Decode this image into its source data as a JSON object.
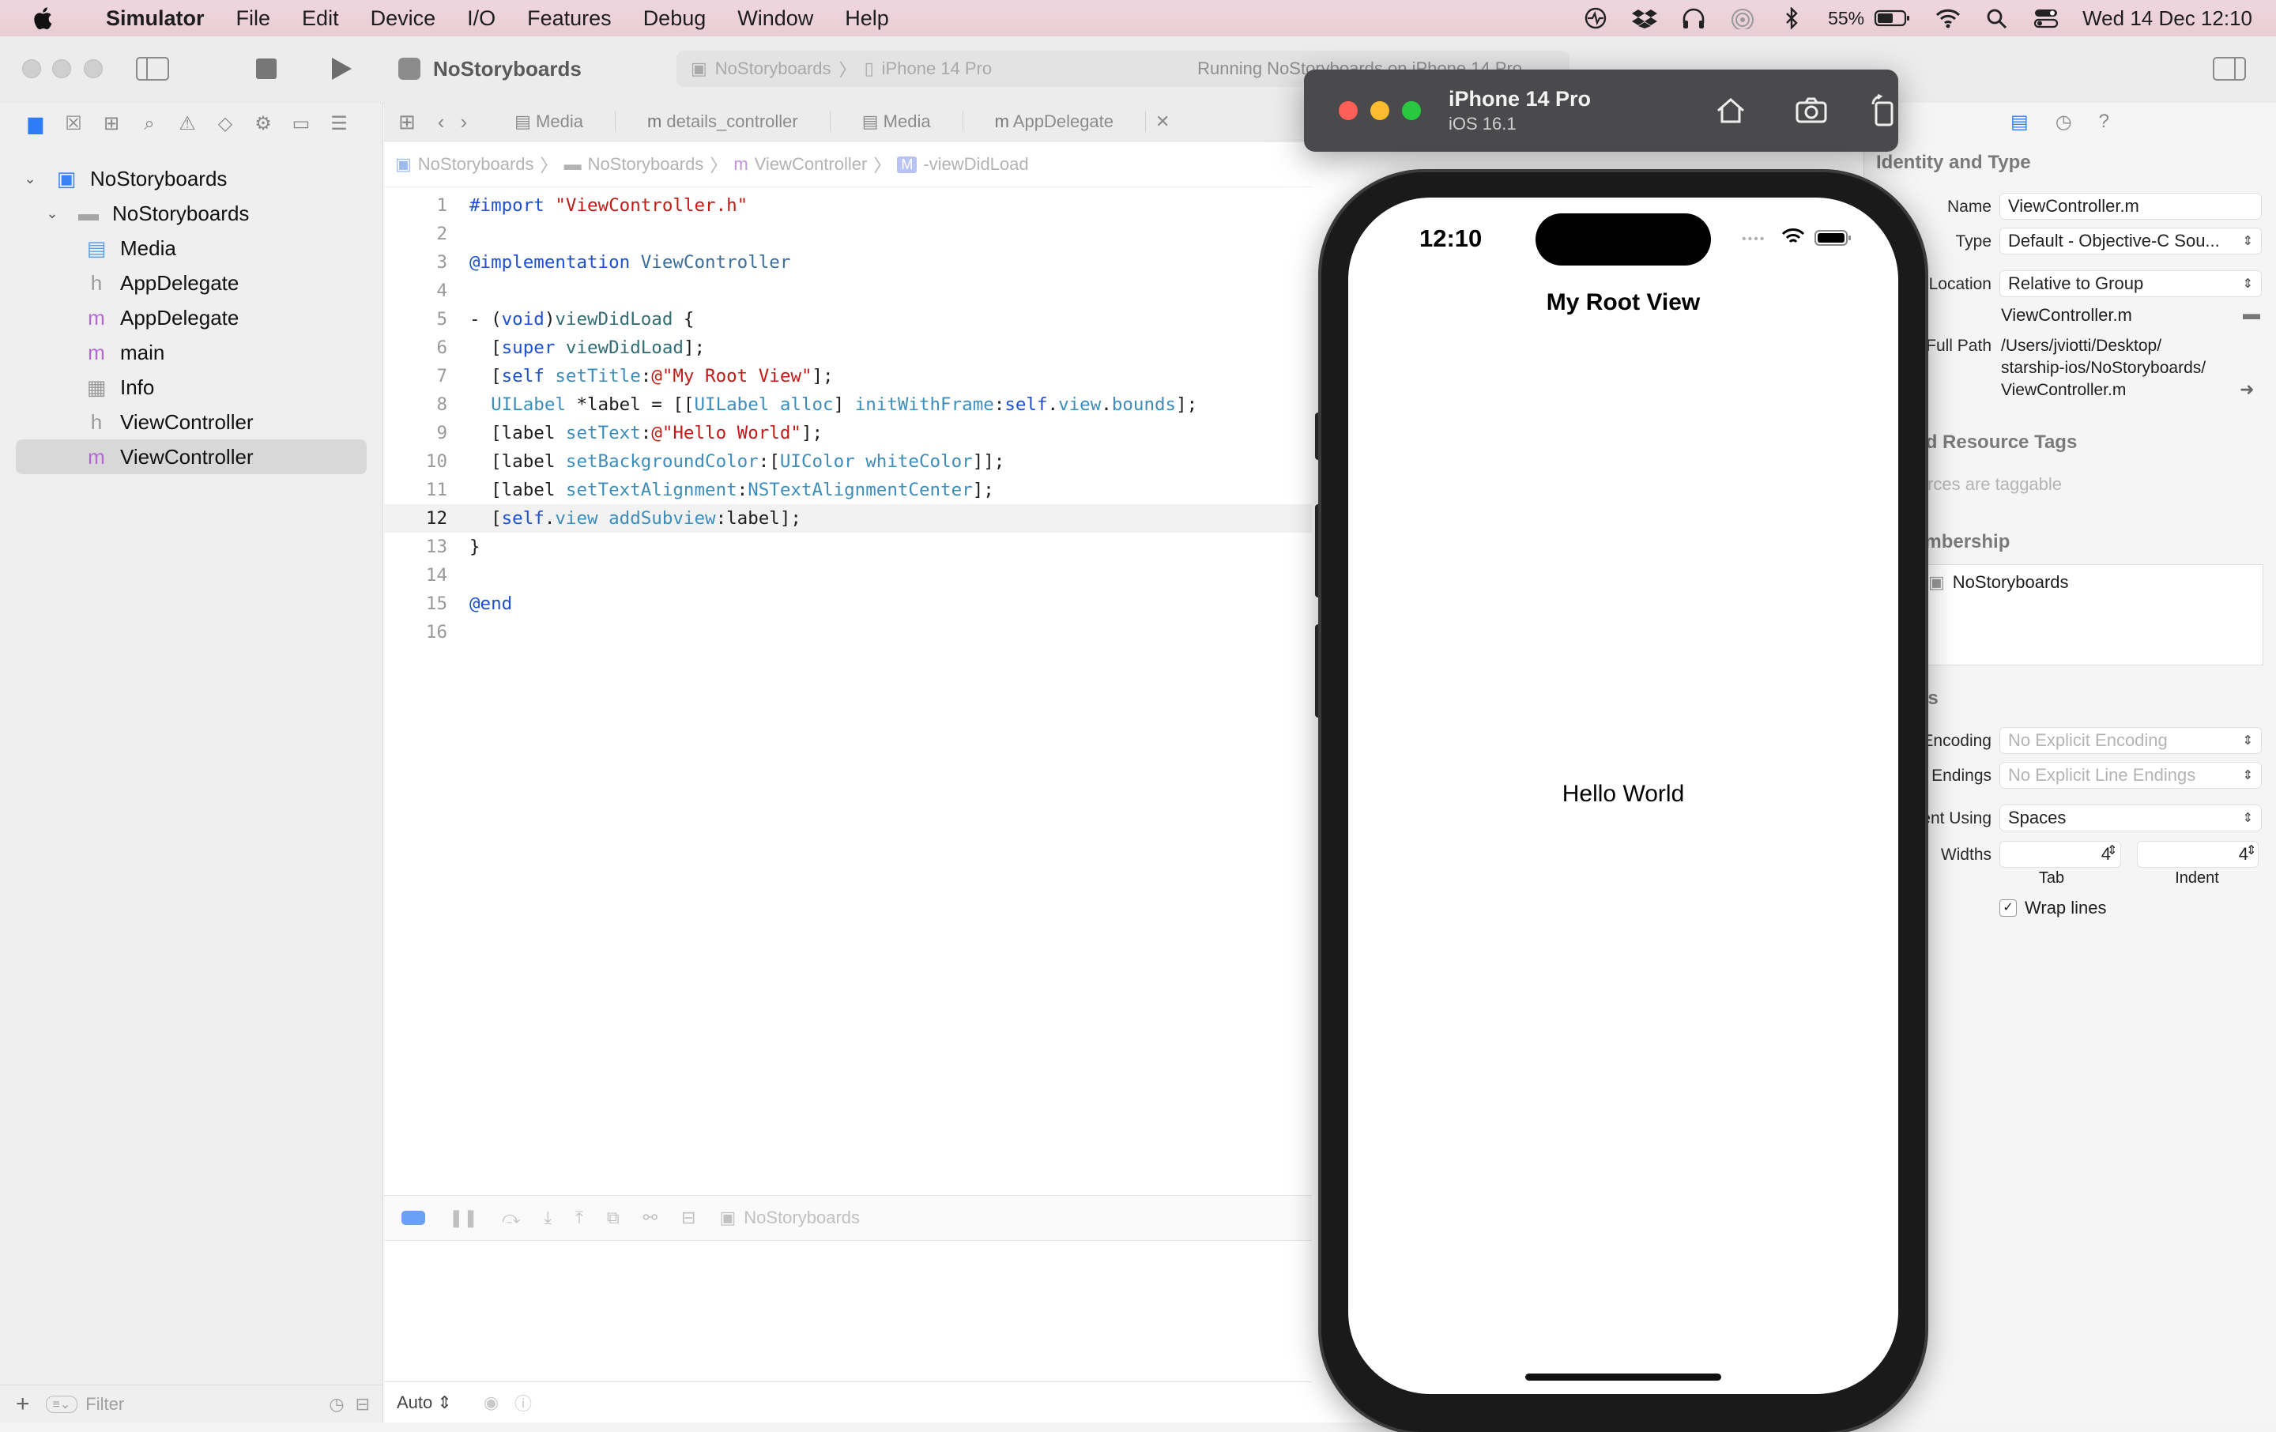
{
  "menubar": {
    "app_name": "Simulator",
    "items": [
      "File",
      "Edit",
      "Device",
      "I/O",
      "Features",
      "Debug",
      "Window",
      "Help"
    ],
    "battery": "55%",
    "datetime": "Wed 14 Dec  12:10"
  },
  "xcode": {
    "project_title": "NoStoryboards",
    "scheme": "NoStoryboards",
    "destination": "iPhone 14 Pro",
    "status": "Running NoStoryboards on iPhone 14 Pro",
    "tabs": [
      "Media",
      "details_controller",
      "Media",
      "AppDelegate"
    ],
    "jumpbar": [
      "NoStoryboards",
      "NoStoryboards",
      "ViewController",
      "-viewDidLoad"
    ],
    "navigator": {
      "project": "NoStoryboards",
      "group": "NoStoryboards",
      "files": [
        {
          "name": "Media",
          "kind": "asset-catalog-icon"
        },
        {
          "name": "AppDelegate",
          "kind": "header-file-icon"
        },
        {
          "name": "AppDelegate",
          "kind": "objc-source-icon"
        },
        {
          "name": "main",
          "kind": "objc-source-icon"
        },
        {
          "name": "Info",
          "kind": "plist-icon"
        },
        {
          "name": "ViewController",
          "kind": "header-file-icon"
        },
        {
          "name": "ViewController",
          "kind": "objc-source-icon"
        }
      ],
      "filter_placeholder": "Filter"
    },
    "code_lines": [
      "#import \"ViewController.h\"",
      "",
      "@implementation ViewController",
      "",
      "- (void)viewDidLoad {",
      "  [super viewDidLoad];",
      "  [self setTitle:@\"My Root View\"];",
      "  UILabel *label = [[UILabel alloc] initWithFrame:self.view.bounds];",
      "  [label setText:@\"Hello World\"];",
      "  [label setBackgroundColor:[UIColor whiteColor]];",
      "  [label setTextAlignment:NSTextAlignmentCenter];",
      "  [self.view addSubview:label];",
      "}",
      "",
      "@end",
      ""
    ],
    "current_line": 12,
    "debug_target": "NoStoryboards",
    "bottom_auto": "Auto"
  },
  "inspector": {
    "identity_header": "Identity and Type",
    "name_label": "Name",
    "name_value": "ViewController.m",
    "type_label": "Type",
    "type_value": "Default - Objective-C Sou...",
    "location_label": "Location",
    "location_value": "Relative to Group",
    "location_file": "ViewController.m",
    "fullpath_label": "Full Path",
    "fullpath_value_1": "/Users/jviotti/Desktop/",
    "fullpath_value_2": "starship-ios/NoStoryboards/",
    "fullpath_value_3": "ViewController.m",
    "odr_header": "emand Resource Tags",
    "odr_hint": "resources are taggable",
    "membership_header": "et Membership",
    "membership_target": "NoStoryboards",
    "settings_header": "ettings",
    "encoding_label": "Encoding",
    "encoding_value": "No Explicit Encoding",
    "endings_label": "Endings",
    "endings_value": "No Explicit Line Endings",
    "indent_label": "ent Using",
    "indent_value": "Spaces",
    "widths_label": "Widths",
    "tab_value": "4",
    "indent_width_value": "4",
    "tab_caption": "Tab",
    "indent_caption": "Indent",
    "wrap_label": "Wrap lines"
  },
  "simulator": {
    "device": "iPhone 14 Pro",
    "os": "iOS 16.1",
    "status_time": "12:10",
    "nav_title": "My Root View",
    "label_text": "Hello World"
  },
  "colors": {
    "keyword": "#9b2393",
    "string": "#c41a16",
    "type": "#3c8dbb",
    "method": "#326d74",
    "directive": "#1f4fd1"
  }
}
